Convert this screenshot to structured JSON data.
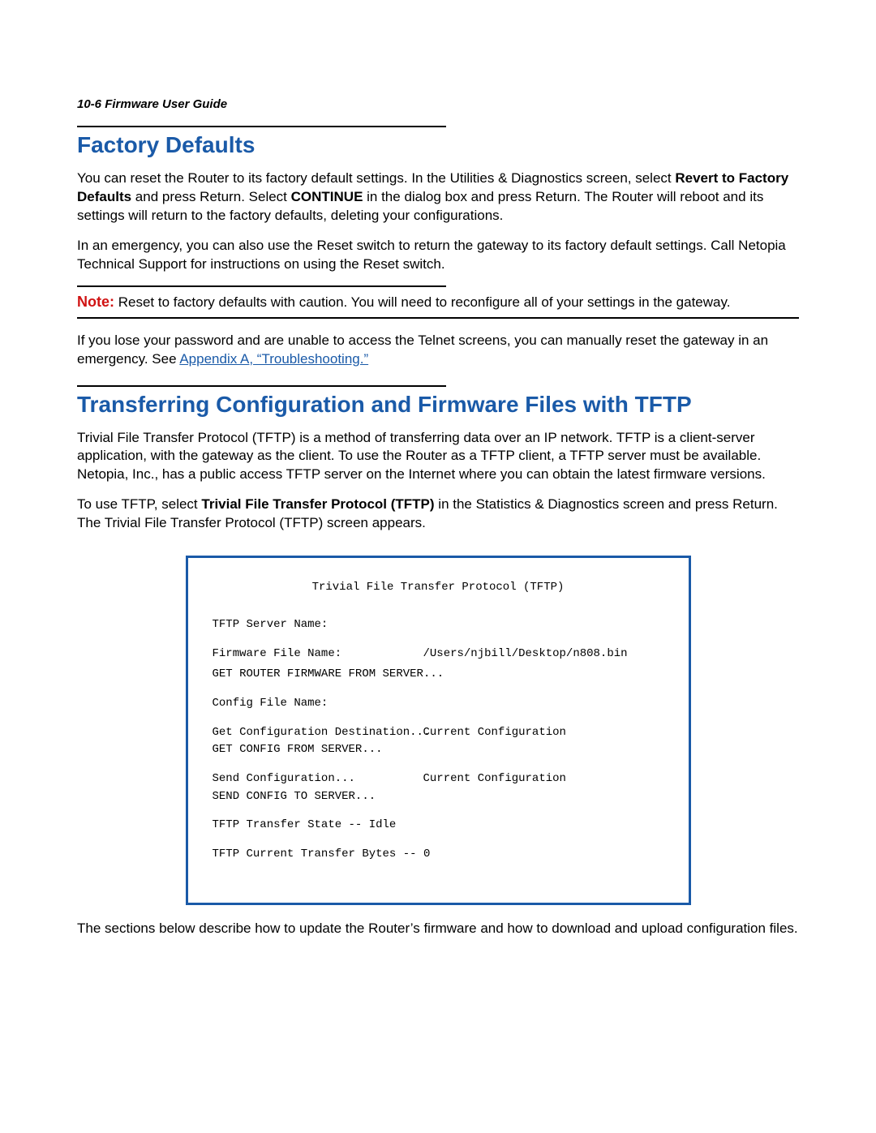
{
  "header": {
    "running": "10-6  Firmware User Guide"
  },
  "section1": {
    "title": "Factory Defaults",
    "p1_a": "You can reset the Router to its factory default settings. In the Utilities & Diagnostics screen, select ",
    "p1_b": "Revert to Factory Defaults",
    "p1_c": " and press Return. Select ",
    "p1_d": "CONTINUE",
    "p1_e": " in the dialog box and press Return. The Router will reboot and its settings will return to the factory defaults, deleting your configurations.",
    "p2": "In an emergency, you can also use the Reset switch to return the gateway to its factory default settings. Call Netopia Technical Support for instructions on using the Reset switch.",
    "note_label": "Note:",
    "note_body": "  Reset to factory defaults with caution. You will need to reconfigure all of your settings in the gateway.",
    "p3_a": "If you lose your password and are unable to access the Telnet screens, you can manually reset the gateway in an emergency. See ",
    "p3_link": "Appendix A, “Troubleshooting.”"
  },
  "section2": {
    "title": "Transferring Configuration and Firmware Files with TFTP",
    "p1": "Trivial File Transfer Protocol (TFTP) is a method of transferring data over an IP network. TFTP is a client-server application, with the gateway as the client. To use the Router as a TFTP client, a TFTP server must be available. Netopia, Inc., has a public access TFTP server on the Internet where you can obtain the latest firmware versions.",
    "p2_a": "To use TFTP, select ",
    "p2_b": "Trivial File Transfer Protocol (TFTP)",
    "p2_c": " in the Statistics & Diagnostics screen and press Return. The Trivial File Transfer Protocol (TFTP) screen appears.",
    "p3": "The sections below describe how to update the Router’s firmware and how to download and upload configuration files."
  },
  "terminal": {
    "title": "Trivial File Transfer Protocol (TFTP)",
    "server_name_lbl": "TFTP Server Name:",
    "fw_file_lbl": "Firmware File Name:",
    "fw_file_val": "/Users/njbill/Desktop/n808.bin",
    "get_fw": "GET ROUTER FIRMWARE FROM SERVER...",
    "cfg_file_lbl": "Config File Name:",
    "get_cfg_dest_lbl": "Get Configuration Destination...",
    "get_cfg_dest_val": "Current Configuration",
    "get_cfg": "GET CONFIG FROM SERVER...",
    "send_cfg_lbl": "Send Configuration...",
    "send_cfg_val": "Current Configuration",
    "send_cfg": "SEND CONFIG TO SERVER...",
    "state": "TFTP Transfer State -- Idle",
    "bytes": "TFTP Current Transfer Bytes -- 0"
  }
}
